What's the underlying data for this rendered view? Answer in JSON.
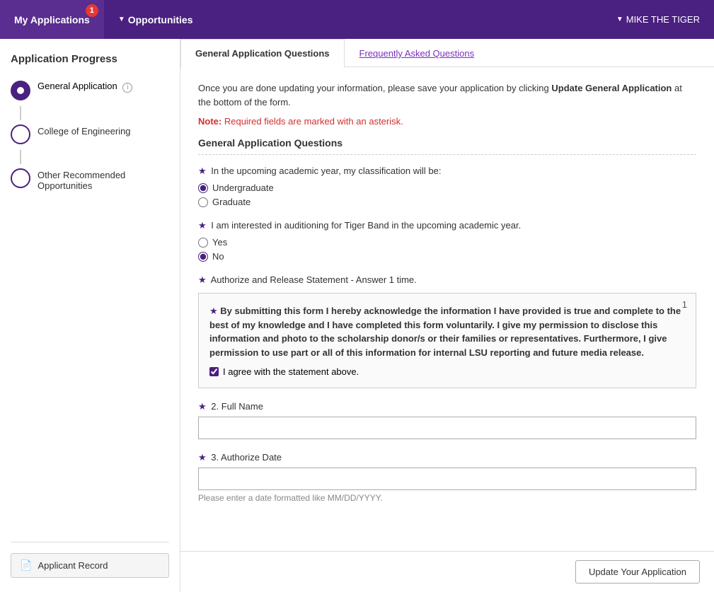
{
  "topNav": {
    "appTitle": "My Applications",
    "badge": "1",
    "opportunitiesLabel": "Opportunities",
    "userMenu": "MIKE THE TIGER"
  },
  "sidebar": {
    "title": "Application Progress",
    "items": [
      {
        "id": "general-application",
        "label": "General Application",
        "state": "filled",
        "info": true
      },
      {
        "id": "college-engineering",
        "label": "College of Engineering",
        "state": "empty",
        "info": false
      },
      {
        "id": "other-opportunities",
        "label": "Other Recommended Opportunities",
        "state": "empty",
        "info": false
      }
    ],
    "applicantRecordLabel": "Applicant Record"
  },
  "tabs": [
    {
      "id": "general-app-questions",
      "label": "General Application Questions",
      "active": true
    },
    {
      "id": "faq",
      "label": "Frequently Asked Questions",
      "active": false
    }
  ],
  "form": {
    "introText": "Once you are done updating your information, please save your application by clicking",
    "introAction": "Update General Application",
    "introSuffix": "at the bottom of the form.",
    "noteLabel": "Note:",
    "noteText": "Required fields are marked with an asterisk.",
    "sectionTitle": "General Application Questions",
    "question1": {
      "label": "In the upcoming academic year, my classification will be:",
      "options": [
        {
          "value": "undergraduate",
          "label": "Undergraduate",
          "checked": true
        },
        {
          "value": "graduate",
          "label": "Graduate",
          "checked": false
        }
      ]
    },
    "question2": {
      "label": "I am interested in auditioning for Tiger Band in the upcoming academic year.",
      "options": [
        {
          "value": "yes",
          "label": "Yes",
          "checked": false
        },
        {
          "value": "no",
          "label": "No",
          "checked": true
        }
      ]
    },
    "authorizeSection": {
      "label": "Authorize and Release Statement - Answer 1 time.",
      "boxNumber": "1",
      "statementStar": "★",
      "statementText": "By submitting this form I hereby acknowledge the information I have provided is true and complete to the best of my knowledge and I have completed this form voluntarily. I give my permission to disclose this information and photo to the scholarship donor/s or their families or representatives. Furthermore, I give permission to use part or all of this information for internal LSU reporting and future media release.",
      "checkboxLabel": "I agree with the statement above.",
      "checkboxChecked": true
    },
    "fullName": {
      "label": "2. Full Name",
      "placeholder": "",
      "value": ""
    },
    "authorizeDate": {
      "label": "3. Authorize Date",
      "placeholder": "",
      "value": "",
      "hint": "Please enter a date formatted like MM/DD/YYYY."
    }
  },
  "bottomBar": {
    "updateButtonLabel": "Update Your Application"
  },
  "colors": {
    "purple": "#4a2080",
    "red": "#d32f2f",
    "linkPurple": "#7b2fbe"
  }
}
